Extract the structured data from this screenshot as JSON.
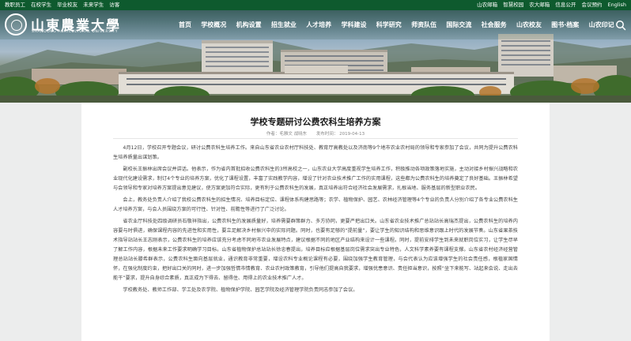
{
  "topbar": {
    "left": [
      "教职员工",
      "在校学生",
      "毕业校友",
      "未来学生",
      "访客"
    ],
    "right": [
      "山农邮箱",
      "智慧校园",
      "农大邮箱",
      "信息公开",
      "会议预约",
      "English"
    ]
  },
  "logo": {
    "cn": "山東農業大學",
    "en": "SHANDONG AGRICULTURAL UNIVERSITY"
  },
  "nav": [
    "首页",
    "学校概况",
    "机构设置",
    "招生就业",
    "人才培养",
    "学科建设",
    "科学研究",
    "师资队伍",
    "国际交流",
    "社会服务",
    "山农校友",
    "图书·档案",
    "山农印记"
  ],
  "article": {
    "title": "学校专题研讨公费农科生培养方案",
    "meta_author": "作者：毛雅文 战晓东",
    "meta_date": "发布时间：  2019-04-13",
    "paragraphs": [
      "4月12日，学校召开专题会议，研讨公费农科生培养工作。来自山东省农业农村厅科技处、教育厅高教处以及济南等9个地市农业农村局的领导和专家参加了会议，共同为提升公费农科生培养质量出谋划策。",
      "副校长王振林出席会议并讲话。他表示，作为省内首批招收公费农科生的3所高校之一，山东农业大学高度重视学生培养工作，积极推动各项政策落地实施，主动对接乡村振兴战略和农业现代化建设需求，制订4个专业的培养方案，优化了课程设置，丰富了实践教学内容，增设了针对农业技术推广工作的实用课程，这些都为公费农科生的培养奠定了良好基础。王振林希望与会领导和专家对培养方案提出意见建议，使方案更加符合实际，更有利于公费农科生的发展，真正培养出符合经济社会发展需求，扎根当地、服务基层的新型职业农民。",
      "会上，教务处负责人介绍了我校公费农科生的招生情况、培养目标定位、课程体系构建思路等；农学、植物保护、园艺、农林经济管理等4个专业的负责人分别介绍了各专业公费农科生人才培养方案，与会人员围绕方案的可行性、针对性、前瞻性等进行了广泛讨论。",
      "省农业厅科技处四级调研员石敬祥指出，公费农科生的发展质量好，培养需要群策群力、多方协同，更要严把出口关。山东省农业技术推广总站站长高瑞杰提出，公费农科生的培养内容要与时俱进，确保课程内容的先进性和实用性，要立足解决乡村振兴中的实际问题。同时，也要有足够的“提前量”，要让学生的知识结构和思维意识跟上时代的发展节奏。山东省果茶技术指导站站长王志刚表示，公费农科生的培养应该充分考虑不同地市农业发展特点，建议根据不同的地区产业结构来设计一些课程。同时，提前安排学生到未来就职岗位实习，让学生尽早了解工作内容，根据未来工作要求明确学习目标。山东省植物保护总站站长徐忠春提出，培养目标应根据基层岗位需求突出专业特色，人文科学素养要有课程支撑。山东省农村经济经营管理总站站长滕希群表示，公费农科生面向基层就业，通识教育非常重要，增设农科专业概论课程有必要，围绕加强学生教育管理，与会代表认为应该增强学生的社会责任感，根植家国情怀，在强化制度约束，把好出口关的同时，进一步加强哲情市情教育、农业农村政策教育，引导他们提高自我要求，增强忧患意识、责任担当意识，按照“坐下来能写、站起来会说、走出去能干”要求，提升自身综合素质，真正成为下得去、留得住、用得上的农业技术推广人才。",
      "学校教务处、教师工作部、学工处及农学院、植物保护学院、园艺学院及经济管理学院负责同志参加了会议。"
    ]
  }
}
